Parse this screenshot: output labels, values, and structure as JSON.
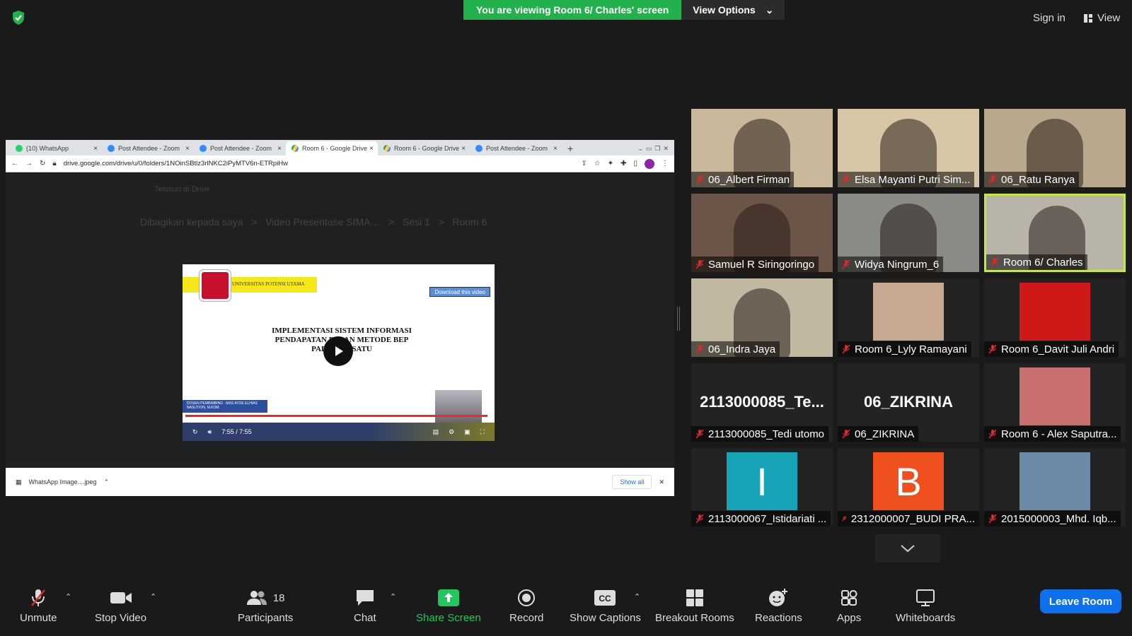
{
  "topbar": {
    "banner_text": "You are viewing Room 6/ Charles' screen",
    "view_options": "View Options",
    "sign_in": "Sign in",
    "view": "View"
  },
  "browser": {
    "tabs": [
      "(10) WhatsApp",
      "Post Attendee - Zoom",
      "Post Attendee - Zoom",
      "Room 6 - Google Drive",
      "Room 6 - Google Drive",
      "Post Attendee - Zoom"
    ],
    "url": "drive.google.com/drive/u/0/folders/1NOinSBtlz3rlNKC2iPyMTV6n-ETRpiHw",
    "drive_search": "Telusuri di Drive",
    "breadcrumb": "Dibagikan kepada saya   >   Video Presentase SIMA…   >   Sesi 1   >   Room 6",
    "download_file": "WhatsApp Image....jpeg",
    "show_all": "Show all"
  },
  "video": {
    "university": "UNIVERSITAS POTENSI UTAMA",
    "download_btn": "Download this video",
    "title_lines": [
      "IMPLEMENTASI SISTEM INFORMASI",
      "PENDAPATAN D     AN METODE BEP",
      "PAD          RSATU"
    ],
    "supervisor": "DOSEN PEMBIMBING : MAS AYOE ELHIAS NASUTION, M.KOM",
    "time": "7:55 / 7:55"
  },
  "participants": [
    {
      "name": "06_Albert Firman",
      "kind": "video",
      "bg": "#c9b89a"
    },
    {
      "name": "Elsa Mayanti Putri Sim...",
      "kind": "video",
      "bg": "#d8c7a6"
    },
    {
      "name": "06_Ratu Ranya",
      "kind": "video",
      "bg": "#b8a88c"
    },
    {
      "name": "Samuel R Siringoringo",
      "kind": "video",
      "bg": "#6b5548"
    },
    {
      "name": "Widya Ningrum_6",
      "kind": "video",
      "bg": "#8a8a86"
    },
    {
      "name": "Room 6/ Charles",
      "kind": "video",
      "bg": "#b9b4a8"
    },
    {
      "name": "06_Indra Jaya",
      "kind": "video",
      "bg": "#c0b8a0"
    },
    {
      "name": "Room 6_Lyly Ramayani",
      "kind": "photo",
      "bg": "#c8a890"
    },
    {
      "name": "Room 6_Davit Juli Andri",
      "kind": "photo",
      "bg": "#d01818"
    },
    {
      "name": "2113000085_Tedi utomo",
      "kind": "text",
      "display": "2113000085_Te..."
    },
    {
      "name": "06_ZIKRINA",
      "kind": "text",
      "display": "06_ZIKRINA"
    },
    {
      "name": "Room 6 - Alex Saputra...",
      "kind": "photo",
      "bg": "#c87070"
    },
    {
      "name": "2113000067_Istidariati ...",
      "kind": "letter",
      "display": "I",
      "bg": "#17a3b8"
    },
    {
      "name": "2312000007_BUDI PRA...",
      "kind": "letter",
      "display": "B",
      "bg": "#f0501e"
    },
    {
      "name": "2015000003_Mhd. Iqb...",
      "kind": "photo",
      "bg": "#6a8aa8"
    }
  ],
  "toolbar": {
    "unmute": "Unmute",
    "stop_video": "Stop Video",
    "participants": "Participants",
    "participants_count": "18",
    "chat": "Chat",
    "share_screen": "Share Screen",
    "record": "Record",
    "show_captions": "Show Captions",
    "breakout_rooms": "Breakout Rooms",
    "reactions": "Reactions",
    "apps": "Apps",
    "whiteboards": "Whiteboards",
    "leave_room": "Leave Room"
  },
  "colors": {
    "banner_green": "#22b14c",
    "leave_blue": "#0e71eb",
    "active_speaker": "#c8e64a",
    "muted_red": "#e02828"
  }
}
